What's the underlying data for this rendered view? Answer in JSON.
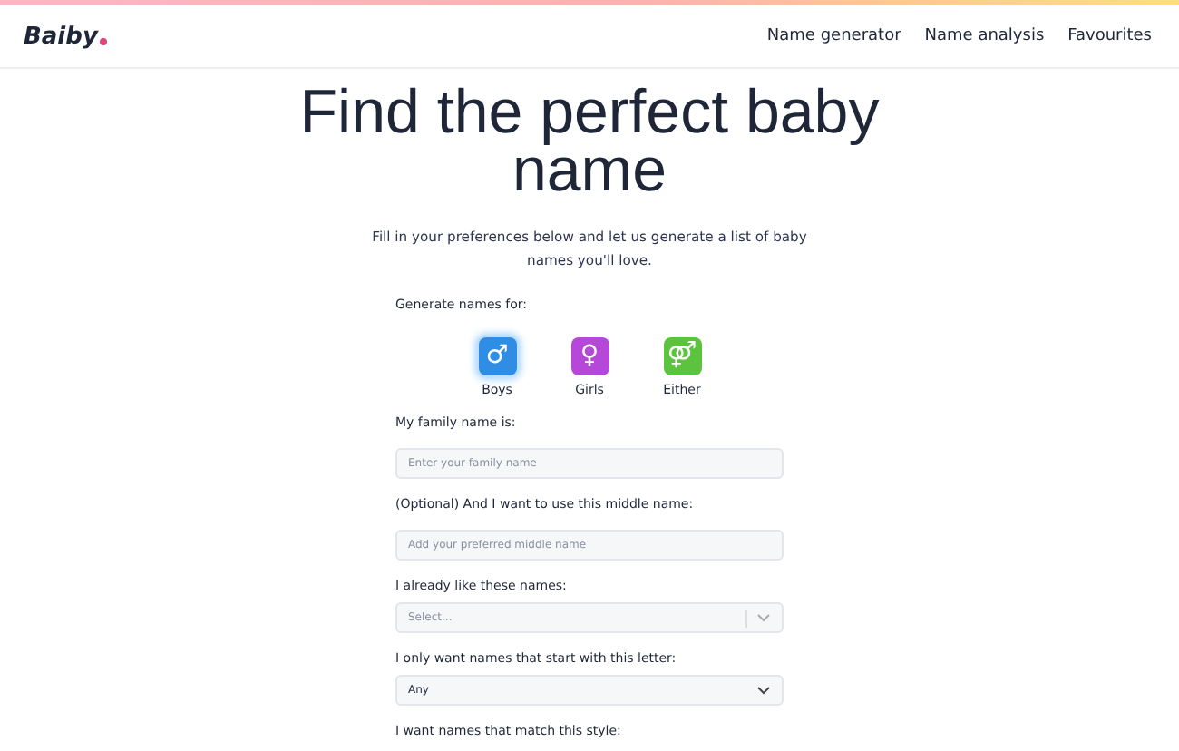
{
  "header": {
    "logo": "Baiby",
    "nav": [
      {
        "label": "Name generator"
      },
      {
        "label": "Name analysis"
      },
      {
        "label": "Favourites"
      }
    ]
  },
  "title": "Find the perfect baby name",
  "intro": "Fill in your preferences below and let us generate a list of baby names you'll love.",
  "gender": {
    "label": "Generate names for:",
    "options": [
      {
        "label": "Boys",
        "symbol": "♂",
        "color": "#2f8de4",
        "selected": true
      },
      {
        "label": "Girls",
        "symbol": "♀",
        "color": "#b548d8",
        "selected": false
      },
      {
        "label": "Either",
        "symbol": "⚤",
        "color": "#5cc33e",
        "selected": false
      }
    ]
  },
  "fields": [
    {
      "kind": "text",
      "label": "My family name is:",
      "placeholder": "Enter your family name"
    },
    {
      "kind": "text",
      "label": "(Optional) And I want to use this middle name:",
      "placeholder": "Add your preferred middle name"
    },
    {
      "kind": "multiselect",
      "label": "I already like these names:",
      "placeholder": "Select..."
    },
    {
      "kind": "select",
      "label": "I only want names that start with this letter:",
      "value": "Any"
    },
    {
      "kind": "label",
      "label": "I want names that match this style:"
    }
  ]
}
